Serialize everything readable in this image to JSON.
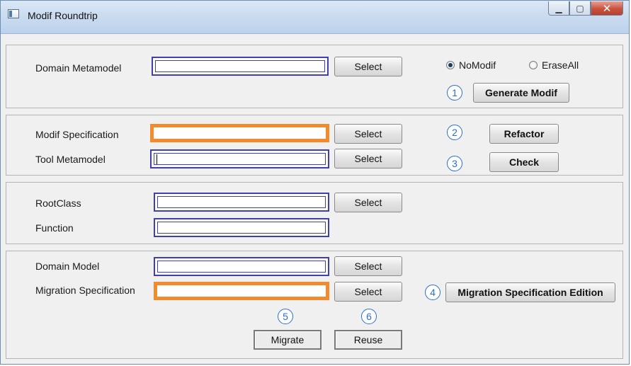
{
  "window": {
    "title": "Modif Roundtrip",
    "icon": "app-window-icon"
  },
  "caption": {
    "minimize": "▁",
    "maximize": "▢",
    "close": "✕"
  },
  "domain_panel": {
    "label": "Domain Metamodel",
    "value": "",
    "select_label": "Select",
    "radio_nomodif": "NoModif",
    "radio_eraseall": "EraseAll",
    "selected_radio": "NoModif",
    "step": "1",
    "generate_label": "Generate Modif"
  },
  "spec_panel": {
    "modif_spec_label": "Modif Specification",
    "modif_spec_value": "",
    "select1_label": "Select",
    "tool_meta_label": "Tool Metamodel",
    "tool_meta_value": "",
    "select2_label": "Select",
    "step_refactor": "2",
    "refactor_label": "Refactor",
    "step_check": "3",
    "check_label": "Check"
  },
  "root_panel": {
    "rootclass_label": "RootClass",
    "rootclass_value": "",
    "select_label": "Select",
    "function_label": "Function",
    "function_value": ""
  },
  "model_panel": {
    "domain_model_label": "Domain Model",
    "domain_model_value": "",
    "select1_label": "Select",
    "migration_spec_label": "Migration Specification",
    "migration_spec_value": "",
    "select2_label": "Select",
    "step_edition": "4",
    "edition_label": "Migration Specification Edition",
    "step_migrate": "5",
    "migrate_label": "Migrate",
    "step_reuse": "6",
    "reuse_label": "Reuse"
  },
  "colors": {
    "field_border": "#3f3fb0",
    "required_border": "#f28a2e",
    "step_badge": "#2a6fc9"
  }
}
